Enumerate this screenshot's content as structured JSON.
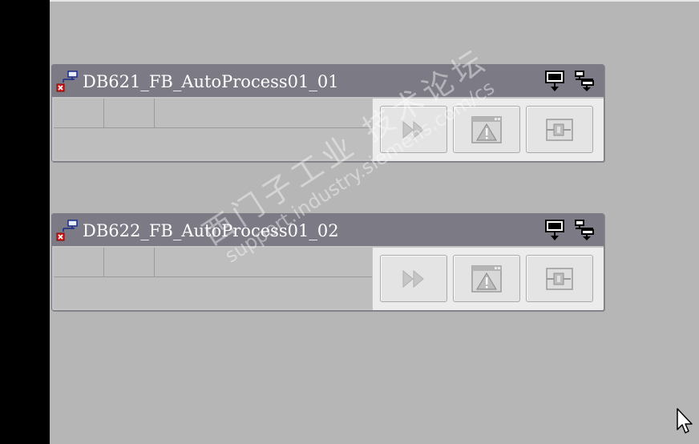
{
  "faceplates": [
    {
      "title": "DB621_FB_AutoProcess01_01",
      "status_icon": "connection-error-icon",
      "header_icons": [
        "display-down-icon",
        "tree-down-icon"
      ],
      "buttons": [
        "fast-forward-icon",
        "warning-window-icon",
        "connector-icon"
      ]
    },
    {
      "title": "DB622_FB_AutoProcess01_02",
      "status_icon": "connection-error-icon",
      "header_icons": [
        "display-down-icon",
        "tree-down-icon"
      ],
      "buttons": [
        "fast-forward-icon",
        "warning-window-icon",
        "connector-icon"
      ]
    }
  ],
  "watermark": {
    "text": "西门子工业 技术论坛",
    "url": "support.industry.siemens.com/cs"
  },
  "colors": {
    "header": "#7c7b85",
    "panel": "#bebebe",
    "button_area": "#ececec",
    "background": "#b6b6b6"
  }
}
